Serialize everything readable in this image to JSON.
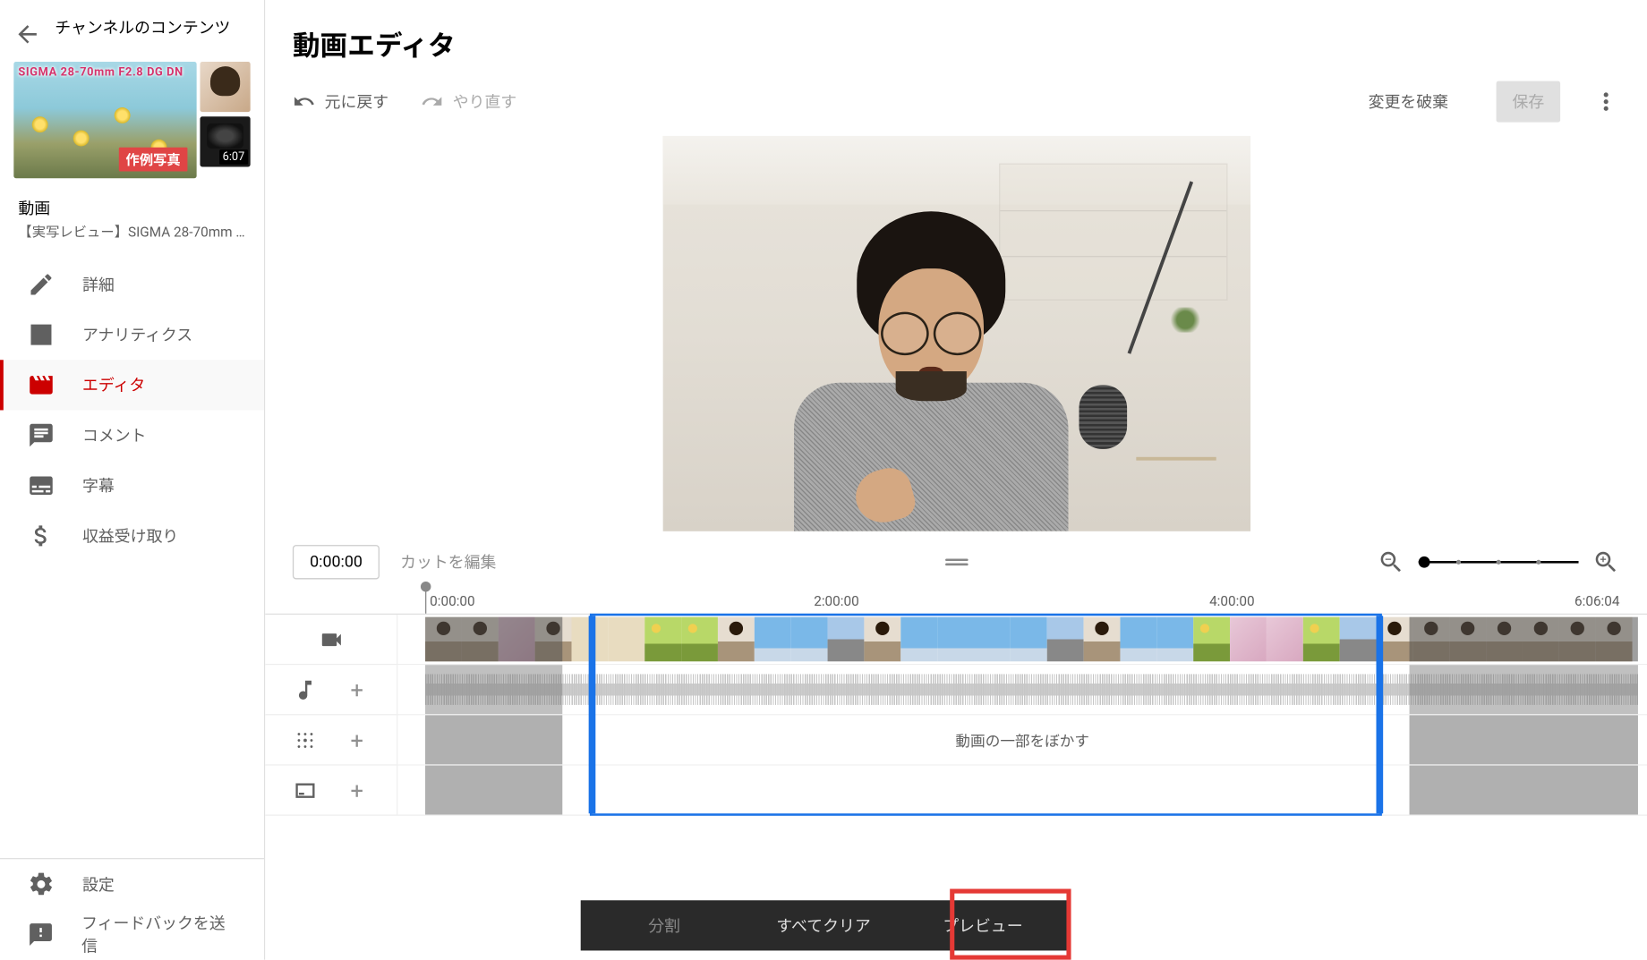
{
  "sidebar": {
    "back_label": "チャンネルのコンテンツ",
    "thumb_top": "SIGMA 28-70mm F2.8 DG DN",
    "thumb_badge": "作例写真",
    "duration": "6:07",
    "video_label": "動画",
    "video_name": "【実写レビュー】SIGMA 28-70mm ...",
    "items": [
      {
        "id": "details",
        "label": "詳細"
      },
      {
        "id": "analytics",
        "label": "アナリティクス"
      },
      {
        "id": "editor",
        "label": "エディタ"
      },
      {
        "id": "comments",
        "label": "コメント"
      },
      {
        "id": "subtitles",
        "label": "字幕"
      },
      {
        "id": "monetization",
        "label": "収益受け取り"
      }
    ],
    "footer": [
      {
        "id": "settings",
        "label": "設定"
      },
      {
        "id": "feedback",
        "label": "フィードバックを送信"
      }
    ]
  },
  "header": {
    "title": "動画エディタ"
  },
  "toolbar": {
    "undo": "元に戻す",
    "redo": "やり直す",
    "discard": "変更を破棄",
    "save": "保存"
  },
  "controls": {
    "time": "0:00:00",
    "edit_cut": "カットを編集"
  },
  "ruler": {
    "t0": "0:00:00",
    "t1": "2:00:00",
    "t2": "4:00:00",
    "t3": "6:06:04"
  },
  "tracks": {
    "blur_label": "動画の一部をぼかす"
  },
  "bottom_bar": {
    "split": "分割",
    "clear_all": "すべてクリア",
    "preview": "プレビュー"
  }
}
